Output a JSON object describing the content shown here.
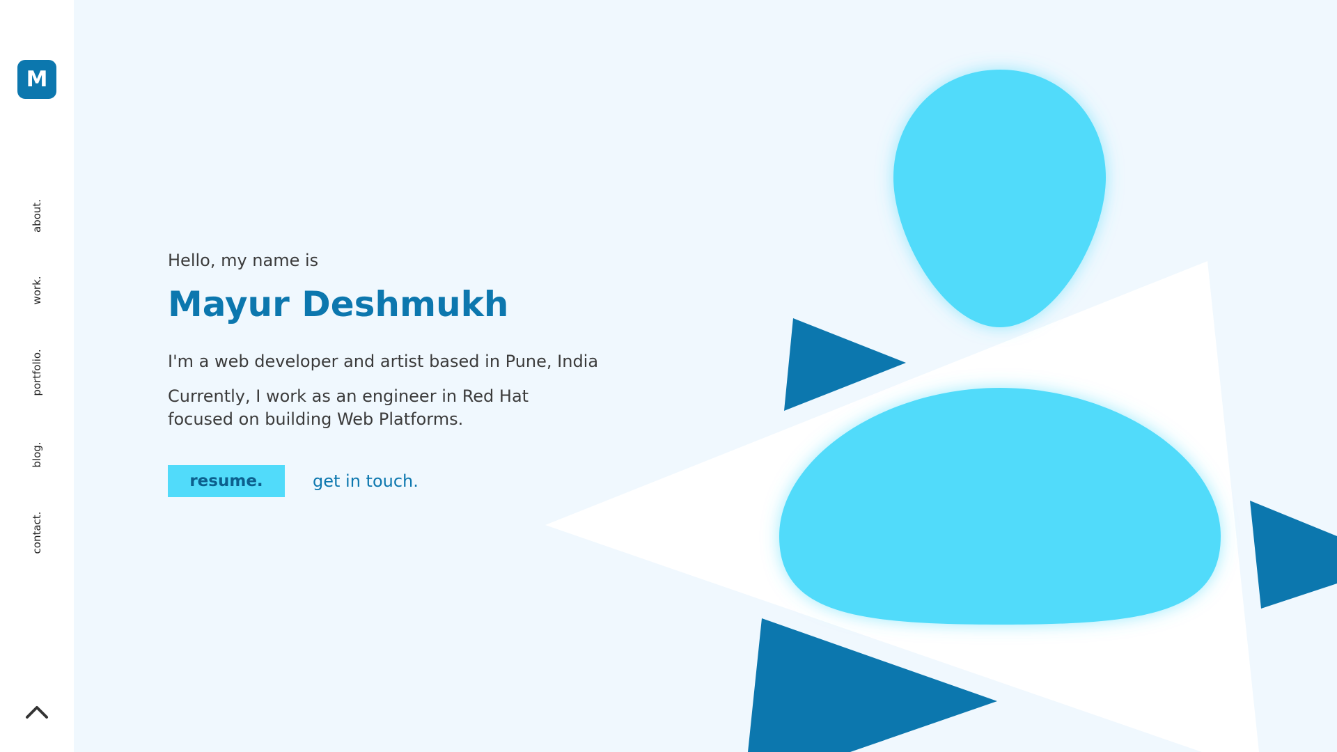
{
  "brand": {
    "logo_letter": "M"
  },
  "sidebar": {
    "items": [
      {
        "label": "about."
      },
      {
        "label": "work."
      },
      {
        "label": "portfolio."
      },
      {
        "label": "blog."
      },
      {
        "label": "contact."
      }
    ],
    "scroll_top_icon": "chevron-up-icon"
  },
  "hero": {
    "greeting": "Hello, my name is",
    "name": "Mayur Deshmukh",
    "bio_line": "I'm a web developer and artist based in Pune, India",
    "bio_work": "Currently, I work as an engineer in Red Hat focused on building Web Platforms.",
    "resume_label": "resume.",
    "contact_label": "get in touch."
  },
  "colors": {
    "accent": "#0c77ae",
    "highlight": "#51dbfa",
    "background": "#f0f8fe",
    "sidebar": "#ffffff"
  }
}
